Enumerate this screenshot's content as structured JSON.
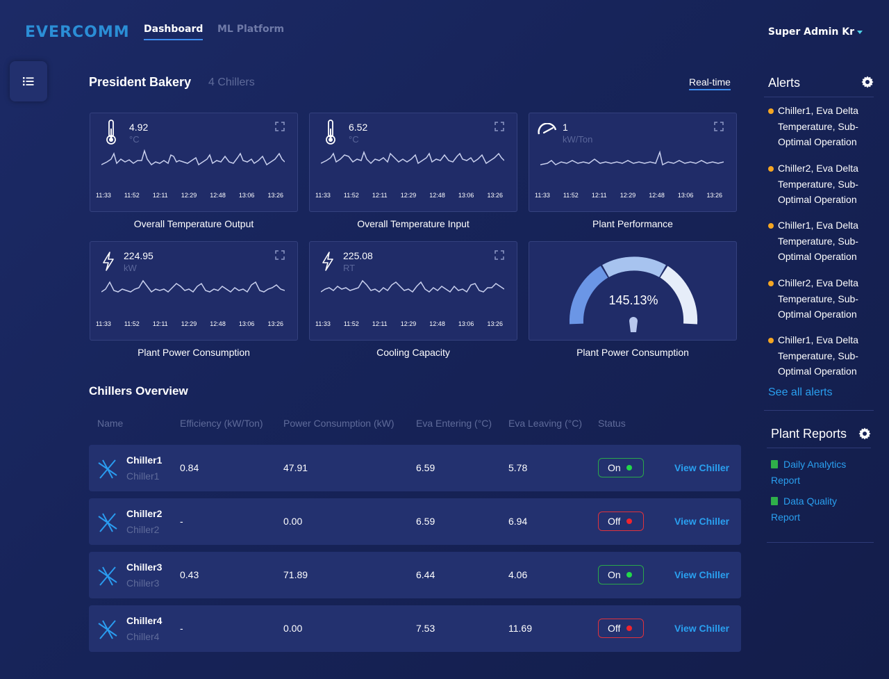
{
  "brand": {
    "logo": "EVERCOMM"
  },
  "nav": {
    "tabs": [
      "Dashboard",
      "ML Platform"
    ],
    "active": "Dashboard"
  },
  "user": {
    "name": "Super Admin Kr"
  },
  "header": {
    "plant_name": "President Bakery",
    "chiller_count": "4 Chillers",
    "mode": "Real-time"
  },
  "times": [
    "11:33",
    "11:52",
    "12:11",
    "12:29",
    "12:48",
    "13:06",
    "13:26"
  ],
  "cards": [
    {
      "value": "4.92",
      "unit": "°C",
      "label": "Overall Temperature Output",
      "icon": "thermometer-icon"
    },
    {
      "value": "6.52",
      "unit": "°C",
      "label": "Overall Temperature Input",
      "icon": "thermometer-icon"
    },
    {
      "value": "1",
      "unit": "kW/Ton",
      "label": "Plant Performance",
      "icon": "gauge-icon"
    },
    {
      "value": "224.95",
      "unit": "kW",
      "label": "Plant Power Consumption",
      "icon": "lightning-icon"
    },
    {
      "value": "225.08",
      "unit": "RT",
      "label": "Cooling Capacity",
      "icon": "lightning-icon"
    }
  ],
  "gauge": {
    "value": "145.13%",
    "label": "Plant Power Consumption",
    "level_percent": 145.13
  },
  "chillers_overview": {
    "title": "Chillers Overview",
    "columns": [
      "Name",
      "Efficiency (kW/Ton)",
      "Power Consumption (kW)",
      "Eva Entering (°C)",
      "Eva Leaving (°C)",
      "Status"
    ],
    "rows": [
      {
        "name": "Chiller1",
        "sub": "Chiller1",
        "efficiency": "0.84",
        "power": "47.91",
        "eva_in": "6.59",
        "eva_out": "5.78",
        "status": "On",
        "action": "View Chiller"
      },
      {
        "name": "Chiller2",
        "sub": "Chiller2",
        "efficiency": "-",
        "power": "0.00",
        "eva_in": "6.59",
        "eva_out": "6.94",
        "status": "Off",
        "action": "View Chiller"
      },
      {
        "name": "Chiller3",
        "sub": "Chiller3",
        "efficiency": "0.43",
        "power": "71.89",
        "eva_in": "6.44",
        "eva_out": "4.06",
        "status": "On",
        "action": "View Chiller"
      },
      {
        "name": "Chiller4",
        "sub": "Chiller4",
        "efficiency": "-",
        "power": "0.00",
        "eva_in": "7.53",
        "eva_out": "11.69",
        "status": "Off",
        "action": "View Chiller"
      }
    ]
  },
  "alerts": {
    "title": "Alerts",
    "items": [
      "Chiller1, Eva Delta Temperature, Sub-Optimal Operation",
      "Chiller2, Eva Delta Temperature, Sub-Optimal Operation",
      "Chiller1, Eva Delta Temperature, Sub-Optimal Operation",
      "Chiller2, Eva Delta Temperature, Sub-Optimal Operation",
      "Chiller1, Eva Delta Temperature, Sub-Optimal Operation"
    ],
    "see_all": "See all alerts"
  },
  "reports": {
    "title": "Plant Reports",
    "items": [
      "Daily Analytics Report",
      "Data Quality Report"
    ]
  },
  "colors": {
    "accent": "#3f8ef0",
    "link": "#2aa0f0",
    "alert": "#f5a623",
    "on": "#22d84a",
    "off": "#f0242e",
    "background": "#1a2660"
  }
}
